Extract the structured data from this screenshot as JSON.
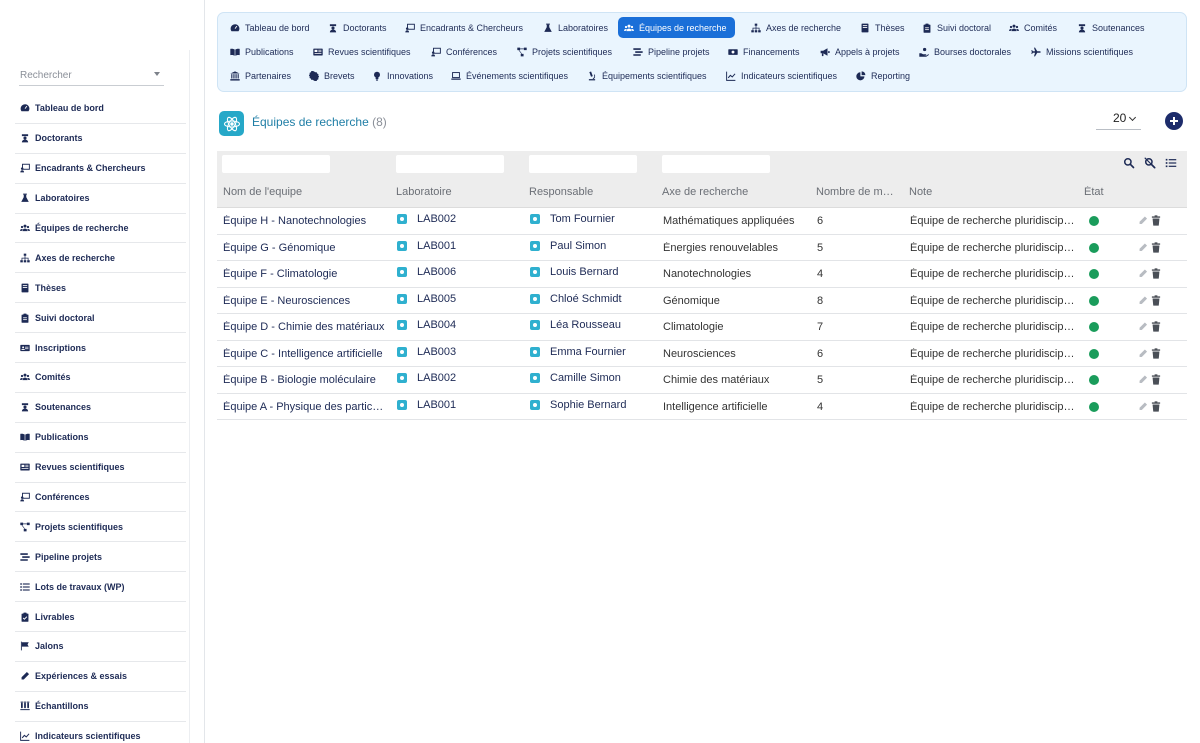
{
  "sidebar": {
    "search_placeholder": "Rechercher",
    "items": [
      {
        "label": "Tableau de bord",
        "icon": "dashboard-icon"
      },
      {
        "label": "Doctorants",
        "icon": "graduate-icon"
      },
      {
        "label": "Encadrants & Chercheurs",
        "icon": "chalkboard-teacher-icon"
      },
      {
        "label": "Laboratoires",
        "icon": "flask-icon"
      },
      {
        "label": "Équipes de recherche",
        "icon": "users-icon"
      },
      {
        "label": "Axes de recherche",
        "icon": "sitemap-icon"
      },
      {
        "label": "Thèses",
        "icon": "book-icon"
      },
      {
        "label": "Suivi doctoral",
        "icon": "clipboard-icon"
      },
      {
        "label": "Inscriptions",
        "icon": "id-card-icon"
      },
      {
        "label": "Comités",
        "icon": "users-icon"
      },
      {
        "label": "Soutenances",
        "icon": "graduate-icon"
      },
      {
        "label": "Publications",
        "icon": "open-book-icon"
      },
      {
        "label": "Revues scientifiques",
        "icon": "newspaper-icon"
      },
      {
        "label": "Conférences",
        "icon": "chalkboard-teacher-icon"
      },
      {
        "label": "Projets scientifiques",
        "icon": "project-diagram-icon"
      },
      {
        "label": "Pipeline projets",
        "icon": "stream-icon"
      },
      {
        "label": "Lots de travaux (WP)",
        "icon": "list-icon"
      },
      {
        "label": "Livrables",
        "icon": "clipboard-check-icon"
      },
      {
        "label": "Jalons",
        "icon": "flag-icon"
      },
      {
        "label": "Expériences & essais",
        "icon": "pen-icon"
      },
      {
        "label": "Échantillons",
        "icon": "vials-icon"
      },
      {
        "label": "Indicateurs scientifiques",
        "icon": "chart-line-icon"
      }
    ]
  },
  "topnav": {
    "rows": [
      [
        {
          "label": "Tableau de bord",
          "icon": "dashboard-icon"
        },
        {
          "label": "Doctorants",
          "icon": "graduate-icon"
        },
        {
          "label": "Encadrants & Chercheurs",
          "icon": "chalkboard-teacher-icon"
        },
        {
          "label": "Laboratoires",
          "icon": "flask-icon"
        },
        {
          "label": "Équipes de recherche",
          "icon": "users-icon",
          "active": true
        },
        {
          "label": "Axes de recherche",
          "icon": "sitemap-icon"
        },
        {
          "label": "Thèses",
          "icon": "book-icon"
        },
        {
          "label": "Suivi doctoral",
          "icon": "clipboard-icon"
        },
        {
          "label": "Comités",
          "icon": "users-icon"
        },
        {
          "label": "Soutenances",
          "icon": "graduate-icon"
        }
      ],
      [
        {
          "label": "Publications",
          "icon": "open-book-icon"
        },
        {
          "label": "Revues scientifiques",
          "icon": "newspaper-icon"
        },
        {
          "label": "Conférences",
          "icon": "chalkboard-teacher-icon"
        },
        {
          "label": "Projets scientifiques",
          "icon": "project-diagram-icon"
        },
        {
          "label": "Pipeline projets",
          "icon": "stream-icon"
        },
        {
          "label": "Financements",
          "icon": "money-icon"
        },
        {
          "label": "Appels à projets",
          "icon": "bullhorn-icon"
        },
        {
          "label": "Bourses doctorales",
          "icon": "hand-holding-icon"
        },
        {
          "label": "Missions scientifiques",
          "icon": "plane-icon"
        }
      ],
      [
        {
          "label": "Partenaires",
          "icon": "landmark-icon"
        },
        {
          "label": "Brevets",
          "icon": "certificate-icon"
        },
        {
          "label": "Innovations",
          "icon": "lightbulb-icon"
        },
        {
          "label": "Événements scientifiques",
          "icon": "laptop-icon"
        },
        {
          "label": "Équipements scientifiques",
          "icon": "microscope-icon"
        },
        {
          "label": "Indicateurs scientifiques",
          "icon": "chart-line-icon"
        },
        {
          "label": "Reporting",
          "icon": "pie-chart-icon"
        }
      ]
    ]
  },
  "page": {
    "title": "Équipes de recherche",
    "count": "(8)",
    "per_page": "20",
    "accent_color": "#1a6fd8",
    "status_color": "#1a9c5b"
  },
  "table": {
    "columns": [
      "Nom de l'equipe",
      "Laboratoire",
      "Responsable",
      "Axe de recherche",
      "Nombre de membres",
      "Note",
      "État"
    ],
    "rows": [
      {
        "name": "Équipe H - Nanotechnologies",
        "lab": "LAB002",
        "resp": "Tom Fournier",
        "axe": "Mathématiques appliquées",
        "nb": "6",
        "note": "Équipe de recherche pluridisciplinaire"
      },
      {
        "name": "Équipe G - Génomique",
        "lab": "LAB001",
        "resp": "Paul Simon",
        "axe": "Énergies renouvelables",
        "nb": "5",
        "note": "Équipe de recherche pluridisciplinaire"
      },
      {
        "name": "Équipe F - Climatologie",
        "lab": "LAB006",
        "resp": "Louis Bernard",
        "axe": "Nanotechnologies",
        "nb": "4",
        "note": "Équipe de recherche pluridisciplinaire"
      },
      {
        "name": "Équipe E - Neurosciences",
        "lab": "LAB005",
        "resp": "Chloé Schmidt",
        "axe": "Génomique",
        "nb": "8",
        "note": "Équipe de recherche pluridisciplinaire"
      },
      {
        "name": "Équipe D - Chimie des matériaux",
        "lab": "LAB004",
        "resp": "Léa Rousseau",
        "axe": "Climatologie",
        "nb": "7",
        "note": "Équipe de recherche pluridisciplinaire"
      },
      {
        "name": "Équipe C - Intelligence artificielle",
        "lab": "LAB003",
        "resp": "Emma Fournier",
        "axe": "Neurosciences",
        "nb": "6",
        "note": "Équipe de recherche pluridisciplinaire"
      },
      {
        "name": "Équipe B - Biologie moléculaire",
        "lab": "LAB002",
        "resp": "Camille Simon",
        "axe": "Chimie des matériaux",
        "nb": "5",
        "note": "Équipe de recherche pluridisciplinaire"
      },
      {
        "name": "Équipe A - Physique des particules",
        "lab": "LAB001",
        "resp": "Sophie Bernard",
        "axe": "Intelligence artificielle",
        "nb": "4",
        "note": "Équipe de recherche pluridisciplinaire"
      }
    ]
  }
}
